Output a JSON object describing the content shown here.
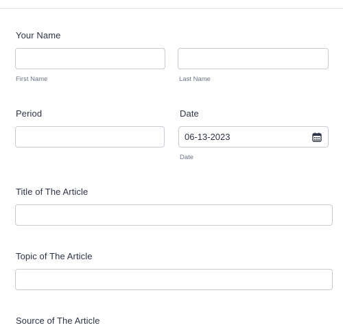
{
  "name_section": {
    "label": "Your Name",
    "first_name": {
      "value": "",
      "sublabel": "First Name"
    },
    "last_name": {
      "value": "",
      "sublabel": "Last Name"
    }
  },
  "period_section": {
    "label": "Period",
    "value": ""
  },
  "date_section": {
    "label": "Date",
    "value": "06-13-2023",
    "sublabel": "Date",
    "icon": "calendar-icon"
  },
  "title_section": {
    "label": "Title of The Article",
    "value": ""
  },
  "topic_section": {
    "label": "Topic of The Article",
    "value": ""
  },
  "source_section": {
    "label": "Source of The Article"
  }
}
